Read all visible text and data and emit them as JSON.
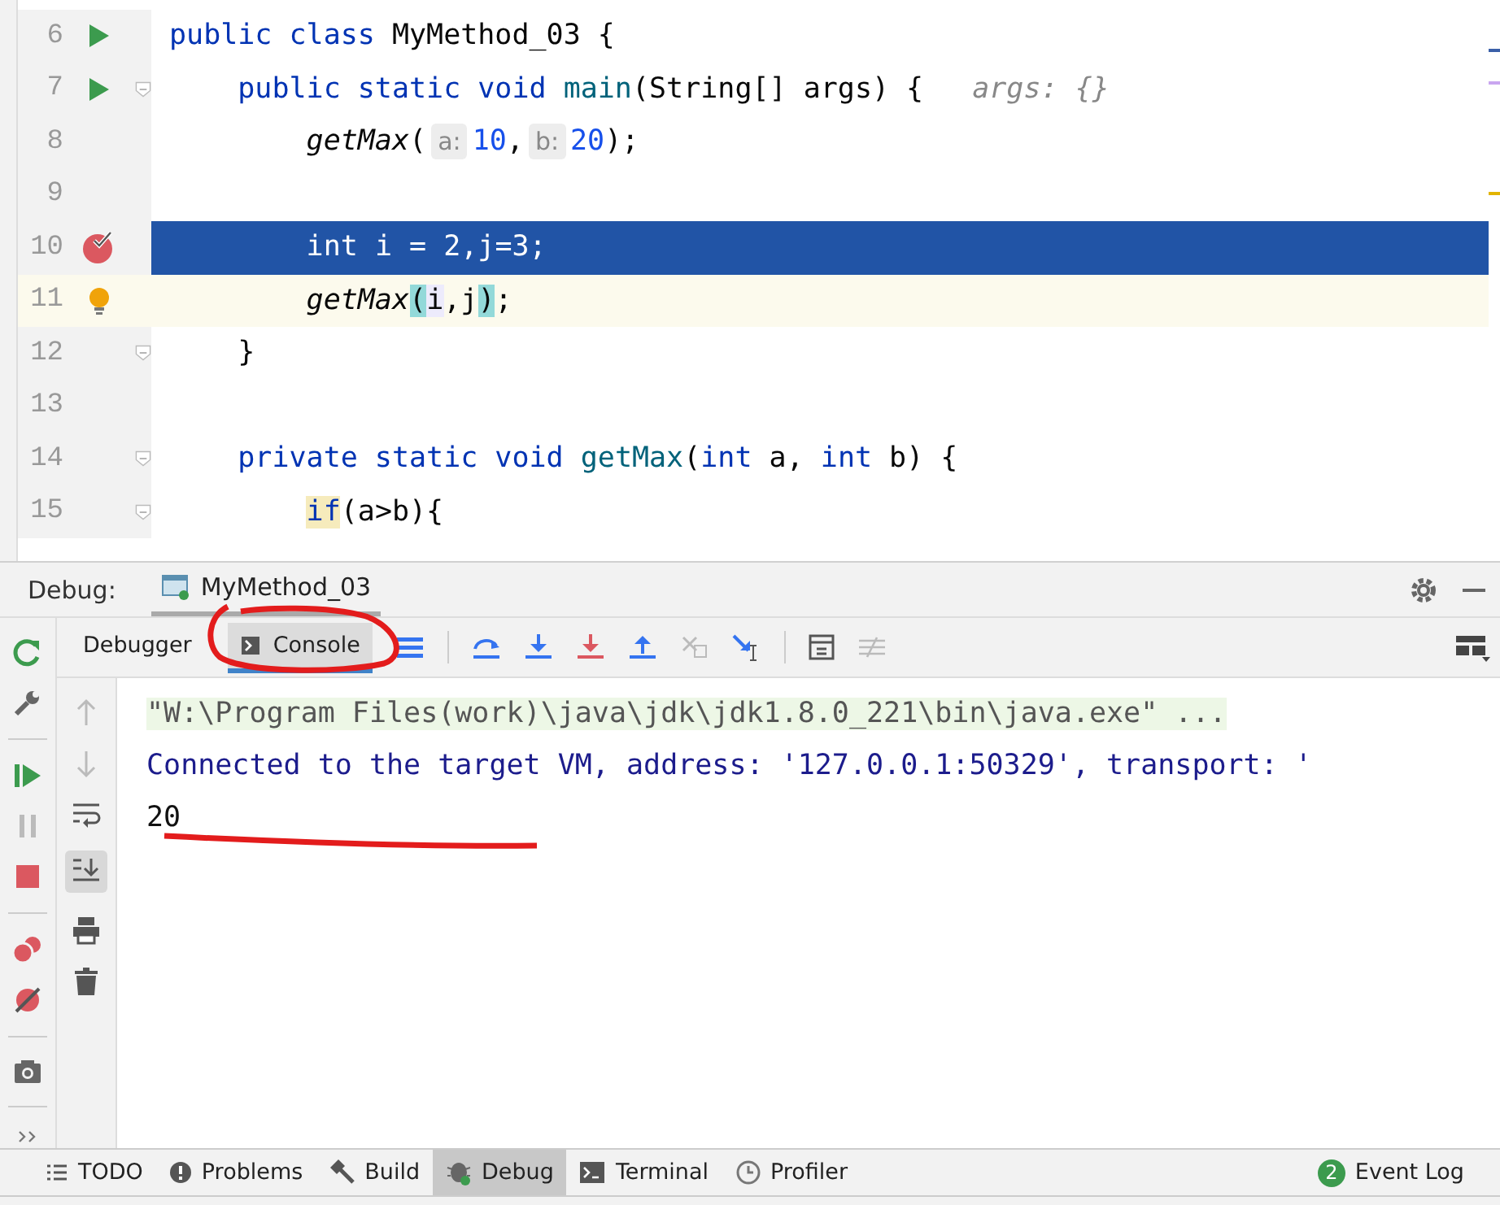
{
  "editor": {
    "lines": [
      {
        "number": "6",
        "kind": "run",
        "fold": false,
        "selected": false,
        "caret_line": false,
        "tokens": [
          {
            "text": "public class ",
            "kind": "kw"
          },
          {
            "text": "MyMethod_03 {",
            "kind": "plain"
          }
        ]
      },
      {
        "number": "7",
        "kind": "run",
        "fold": true,
        "selected": false,
        "caret_line": false,
        "tokens": [
          {
            "text": "    public static void ",
            "kind": "kw"
          },
          {
            "text": "main",
            "kind": "decl"
          },
          {
            "text": "(String[] args) {",
            "kind": "plain"
          },
          {
            "text": "args: {}",
            "kind": "inlay"
          }
        ]
      },
      {
        "number": "8",
        "kind": "plain",
        "fold": false,
        "selected": false,
        "caret_line": false,
        "tokens": [
          {
            "text": "        getMax",
            "kind": "call"
          },
          {
            "text": "(",
            "kind": "plain"
          },
          {
            "text": "a:",
            "kind": "hint"
          },
          {
            "text": "10",
            "kind": "num"
          },
          {
            "text": ",",
            "kind": "plain"
          },
          {
            "text": "b:",
            "kind": "hint"
          },
          {
            "text": "20",
            "kind": "num"
          },
          {
            "text": ");",
            "kind": "plain"
          }
        ]
      },
      {
        "number": "9",
        "kind": "plain",
        "fold": false,
        "selected": false,
        "caret_line": false
      },
      {
        "number": "10",
        "kind": "breakpoint",
        "fold": false,
        "selected": true,
        "caret_line": false,
        "tokens": [
          {
            "text": "        int",
            "kind": "kw"
          },
          {
            "text": " i = 2,j=3;",
            "kind": "plain"
          }
        ]
      },
      {
        "number": "11",
        "kind": "bulb",
        "fold": false,
        "selected": false,
        "caret_line": true,
        "tokens": [
          {
            "text": "        getMax",
            "kind": "call"
          },
          {
            "text": "(",
            "kind": "brace"
          },
          {
            "text": "i",
            "kind": "usage"
          },
          {
            "text": ",j",
            "kind": "plain"
          },
          {
            "text": ")",
            "kind": "brace"
          },
          {
            "text": ";",
            "kind": "plain"
          }
        ]
      },
      {
        "number": "12",
        "kind": "plain",
        "fold": true,
        "selected": false,
        "caret_line": false,
        "tokens": [
          {
            "text": "    }",
            "kind": "plain"
          }
        ]
      },
      {
        "number": "13",
        "kind": "plain",
        "fold": false,
        "selected": false,
        "caret_line": false
      },
      {
        "number": "14",
        "kind": "plain",
        "fold": true,
        "selected": false,
        "caret_line": false,
        "tokens": [
          {
            "text": "    private static void ",
            "kind": "kw"
          },
          {
            "text": "getMax",
            "kind": "decl"
          },
          {
            "text": "(",
            "kind": "plain"
          },
          {
            "text": "int",
            "kind": "kw"
          },
          {
            "text": " a, ",
            "kind": "plain"
          },
          {
            "text": "int",
            "kind": "kw"
          },
          {
            "text": " b) {",
            "kind": "plain"
          }
        ]
      },
      {
        "number": "15",
        "kind": "plain",
        "fold": true,
        "selected": false,
        "caret_line": false,
        "tokens": [
          {
            "text": "        if",
            "kind": "mark"
          },
          {
            "text": "(a>b){",
            "kind": "plain"
          }
        ]
      }
    ]
  },
  "debug_panel": {
    "label": "Debug:",
    "session_tab": "MyMethod_03",
    "tabs": [
      {
        "label": "Debugger",
        "selected": false
      },
      {
        "label": "Console",
        "selected": true
      }
    ],
    "console_lines": [
      {
        "text": "\"W:\\Program Files(work)\\java\\jdk\\jdk1.8.0_221\\bin\\java.exe\" ...",
        "kind": "command"
      },
      {
        "text": "Connected to the target VM, address: '127.0.0.1:50329', transport: '",
        "kind": "info"
      },
      {
        "text": "20",
        "kind": "output"
      }
    ]
  },
  "tool_windows": [
    {
      "label": "TODO",
      "selected": false
    },
    {
      "label": "Problems",
      "selected": false
    },
    {
      "label": "Build",
      "selected": false
    },
    {
      "label": "Debug",
      "selected": true
    },
    {
      "label": "Terminal",
      "selected": false
    },
    {
      "label": "Profiler",
      "selected": false
    }
  ],
  "event_log": {
    "label": "Event Log",
    "badge": "2"
  }
}
